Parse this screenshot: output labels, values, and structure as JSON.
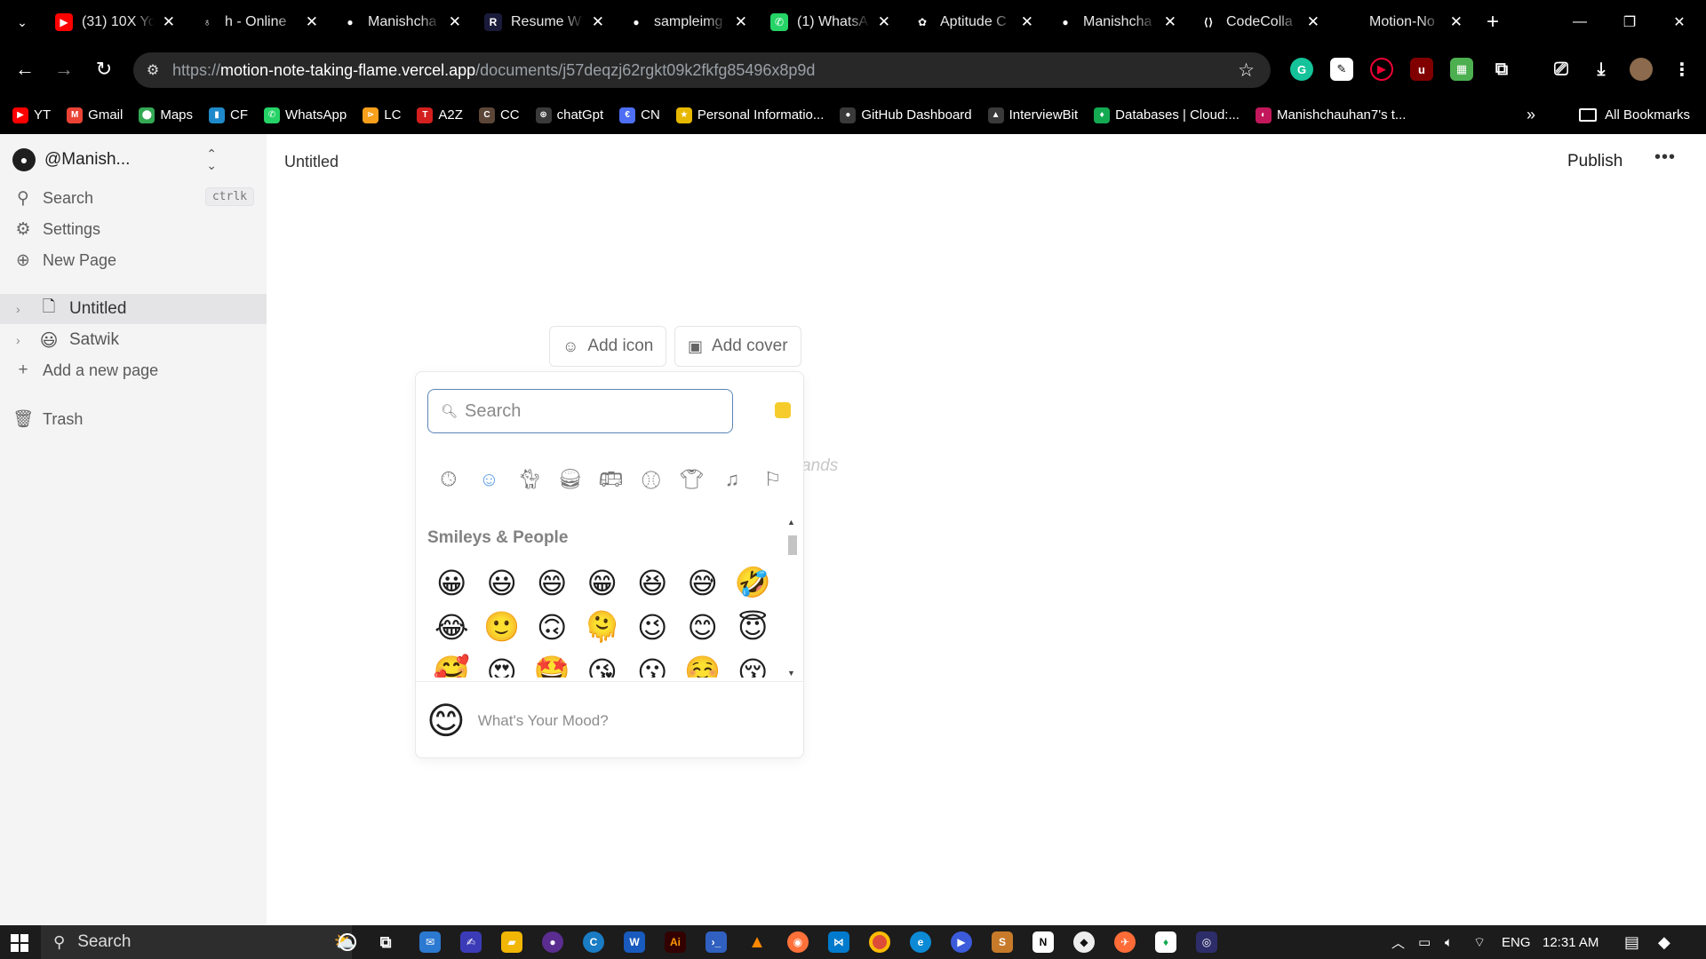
{
  "browser": {
    "tabs": [
      {
        "title": "(31) 10X Yo",
        "icon": "youtube-icon",
        "color": "#ff0000",
        "glyph": "▶"
      },
      {
        "title": "h - Online",
        "icon": "leaf-icon",
        "color": "#000000",
        "glyph": "♁"
      },
      {
        "title": "Manishcha",
        "icon": "github-icon",
        "color": "#000000",
        "glyph": "●"
      },
      {
        "title": "Resume W",
        "icon": "resume-icon",
        "color": "#1a1a3a",
        "glyph": "R"
      },
      {
        "title": "sampleimg",
        "icon": "github-icon",
        "color": "#000000",
        "glyph": "●"
      },
      {
        "title": "(1) WhatsA",
        "icon": "whatsapp-icon",
        "color": "#25d366",
        "glyph": "✆"
      },
      {
        "title": "Aptitude C",
        "icon": "aptitude-icon",
        "color": "#000000",
        "glyph": "✿"
      },
      {
        "title": "Manishcha",
        "icon": "github-icon",
        "color": "#000000",
        "glyph": "●"
      },
      {
        "title": "CodeColla",
        "icon": "code-icon",
        "color": "#000000",
        "glyph": "⟨⟩"
      },
      {
        "title": "Motion-No",
        "icon": "motion-icon",
        "color": "#000000",
        "glyph": ""
      }
    ],
    "url_host": "motion-note-taking-flame.vercel.app",
    "url_path": "/documents/j57deqzj62rgkt09k2fkfg85496x8p9d",
    "url_scheme": "https://",
    "bookmarks": [
      {
        "label": "YT",
        "color": "#ff0000",
        "glyph": "▶"
      },
      {
        "label": "Gmail",
        "color": "#ea4335",
        "glyph": "M"
      },
      {
        "label": "Maps",
        "color": "#34a853",
        "glyph": "⬤"
      },
      {
        "label": "CF",
        "color": "#1f8acb",
        "glyph": "▮"
      },
      {
        "label": "WhatsApp",
        "color": "#25d366",
        "glyph": "✆"
      },
      {
        "label": "LC",
        "color": "#f89f1b",
        "glyph": "⋗"
      },
      {
        "label": "A2Z",
        "color": "#d41f1f",
        "glyph": "T"
      },
      {
        "label": "CC",
        "color": "#5b4638",
        "glyph": "C"
      },
      {
        "label": "chatGpt",
        "color": "#3a3a3a",
        "glyph": "⊛"
      },
      {
        "label": "CN",
        "color": "#4d6ef5",
        "glyph": "€"
      },
      {
        "label": "Personal Informatio...",
        "color": "#e6b800",
        "glyph": "★"
      },
      {
        "label": "GitHub Dashboard",
        "color": "#3a3a3a",
        "glyph": "●"
      },
      {
        "label": "InterviewBit",
        "color": "#3a3a3a",
        "glyph": "▲"
      },
      {
        "label": "Databases | Cloud:...",
        "color": "#13aa52",
        "glyph": "♦"
      },
      {
        "label": "Manishchauhan7's t...",
        "color": "#c2185b",
        "glyph": "◐"
      }
    ],
    "all_bookmarks": "All Bookmarks"
  },
  "sidebar": {
    "workspace": "@Manish...",
    "search_label": "Search",
    "search_shortcut": "ctrlk",
    "settings_label": "Settings",
    "new_page_label": "New Page",
    "pages": [
      {
        "title": "Untitled",
        "icon": "📄"
      },
      {
        "title": "Satwik",
        "icon": "😃"
      }
    ],
    "add_page_label": "Add a new page",
    "trash_label": "Trash"
  },
  "main": {
    "breadcrumb": "Untitled",
    "publish_label": "Publish",
    "add_icon_label": "Add icon",
    "add_cover_label": "Add cover",
    "hint_text": "ands"
  },
  "emoji_picker": {
    "search_placeholder": "Search",
    "skin_tone_color": "#f5cc2b",
    "active_color": "#5d9ee6",
    "categories": [
      "recent",
      "smileys",
      "animals",
      "food",
      "travel",
      "activity",
      "objects",
      "symbols",
      "flags"
    ],
    "section_title": "Smileys & People",
    "emojis": [
      "😀",
      "😃",
      "😄",
      "😁",
      "😆",
      "😅",
      "🤣",
      "😂",
      "🙂",
      "🙃",
      "🫠",
      "😉",
      "😊",
      "😇",
      "🥰",
      "😍",
      "🤩",
      "😘",
      "😗",
      "☺️",
      "😚"
    ],
    "preview_emoji": "😊",
    "preview_text": "What's Your Mood?"
  },
  "taskbar": {
    "search_label": "Search",
    "language": "ENG",
    "time": "12:31 AM"
  }
}
